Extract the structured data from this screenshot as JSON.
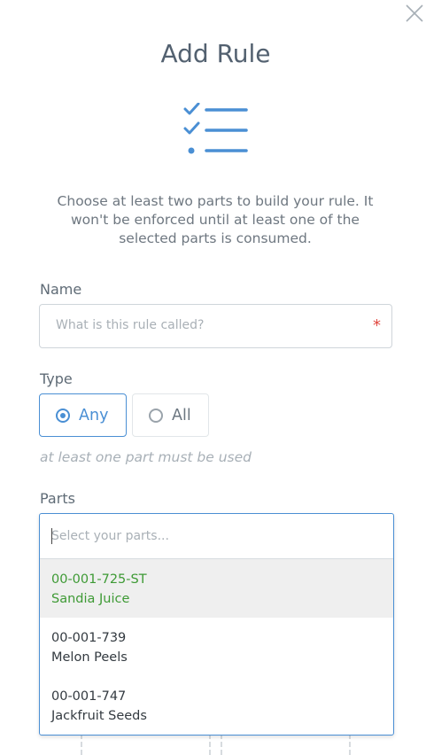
{
  "dialog": {
    "title": "Add Rule",
    "description": "Choose at least two parts to build your rule. It won't be enforced until at least one of the selected parts is consumed.",
    "close_icon": "close-icon",
    "header_icon": "checklist-icon"
  },
  "name_field": {
    "label": "Name",
    "placeholder": "What is this rule called?",
    "value": "",
    "required_mark": "*"
  },
  "type_field": {
    "label": "Type",
    "options": [
      {
        "label": "Any",
        "selected": true
      },
      {
        "label": "All",
        "selected": false
      }
    ],
    "hint": "at least one part must be used"
  },
  "parts_field": {
    "label": "Parts",
    "placeholder": "Select your parts...",
    "options": [
      {
        "code": "00-001-725-ST",
        "name": "Sandia Juice",
        "highlighted": true
      },
      {
        "code": "00-001-739",
        "name": "Melon Peels",
        "highlighted": false
      },
      {
        "code": "00-001-747",
        "name": "Jackfruit Seeds",
        "highlighted": false
      }
    ]
  },
  "colors": {
    "accent": "#4a8fd4",
    "highlight_text": "#3e9a35",
    "required": "#e0473f"
  }
}
